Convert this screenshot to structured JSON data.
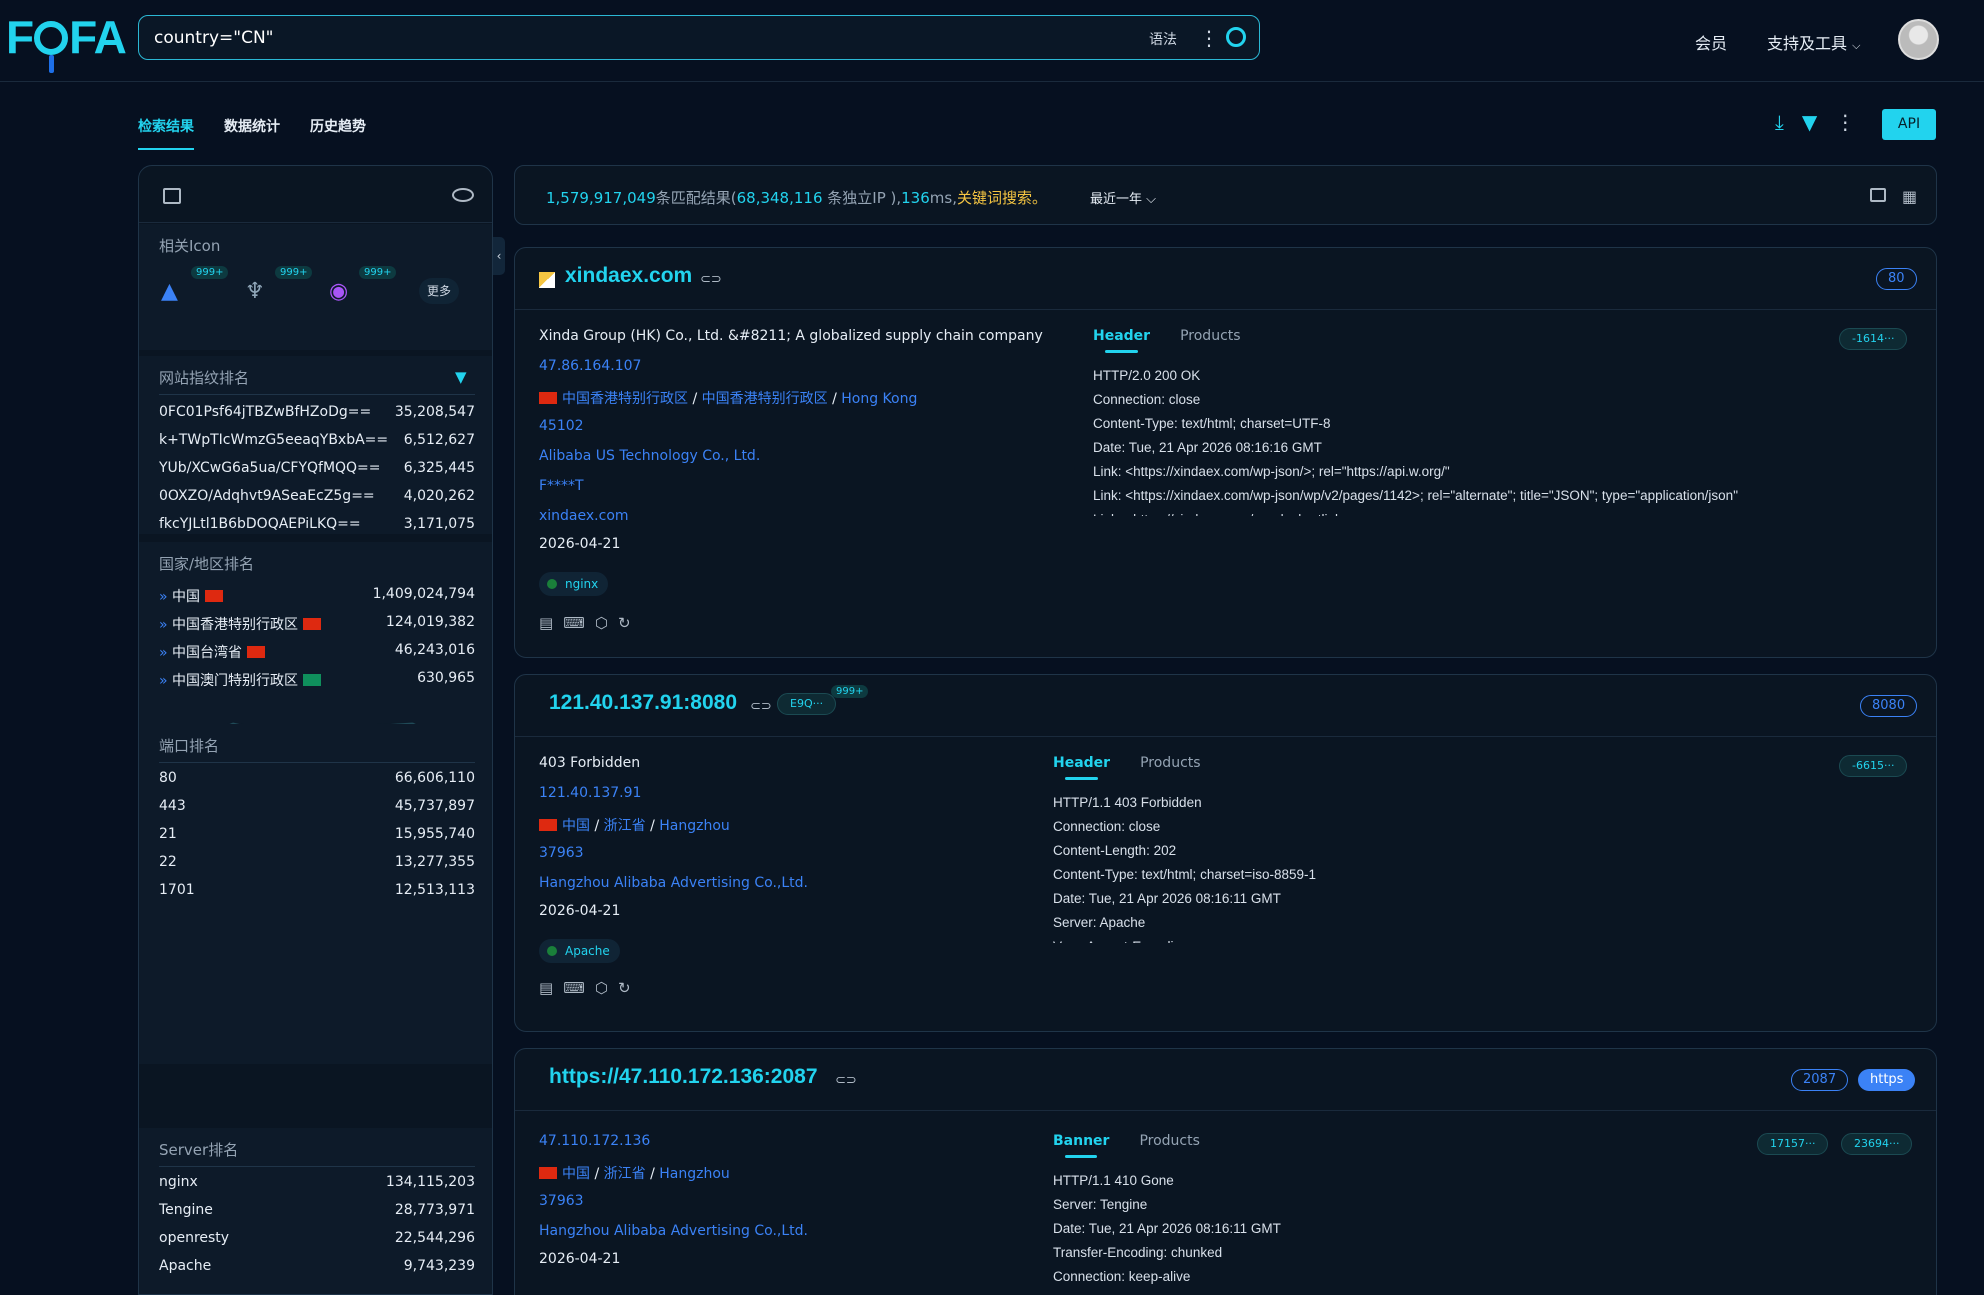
{
  "header": {
    "logo": "FOFA",
    "query": "country=\"CN\"",
    "syntax": "语法",
    "member": "会员",
    "tools": "支持及工具"
  },
  "tabs": [
    "检索结果",
    "数据统计",
    "历史趋势"
  ],
  "api": "API",
  "summary": {
    "total": "1,579,917,049",
    "t1": "条匹配结果(",
    "ips": "68,348,116",
    "t2": " 条独立IP ),",
    "ms": "136",
    "t3": "ms,",
    "kw": "关键词搜索。",
    "range": "最近一年"
  },
  "sidebar": {
    "icon_title": "相关Icon",
    "badge": "999+",
    "more": "更多",
    "fp_title": "网站指纹排名",
    "fp": [
      [
        "0FC01Psf64jTBZwBfHZoDg==",
        "35,208,547"
      ],
      [
        "k+TWpTIcWmzG5eeaqYBxbA==",
        "6,512,627"
      ],
      [
        "YUb/XCwG6a5ua/CFYQfMQQ==",
        "6,325,445"
      ],
      [
        "0OXZO/Adqhvt9ASeaEcZ5g==",
        "4,020,262"
      ],
      [
        "fkcYJLtl1B6bDOQAEPiLKQ==",
        "3,171,075"
      ]
    ],
    "country_title": "国家/地区排名",
    "countries": [
      [
        "中国",
        "1,409,024,794"
      ],
      [
        "中国香港特别行政区",
        "124,019,382"
      ],
      [
        "中国台湾省",
        "46,243,016"
      ],
      [
        "中国澳门特别行政区",
        "630,965"
      ]
    ],
    "port_title": "端口排名",
    "ports": [
      [
        "80",
        "66,606,110"
      ],
      [
        "443",
        "45,737,897"
      ],
      [
        "21",
        "15,955,740"
      ],
      [
        "22",
        "13,277,355"
      ],
      [
        "1701",
        "12,513,113"
      ]
    ],
    "server_title": "Server排名",
    "servers": [
      [
        "nginx",
        "134,115,203"
      ],
      [
        "Tengine",
        "28,773,971"
      ],
      [
        "openresty",
        "22,544,296"
      ],
      [
        "Apache",
        "9,743,239"
      ]
    ]
  },
  "cards": [
    {
      "host": "xindaex.com",
      "port": "80",
      "title": "Xinda Group (HK) Co., Ltd. &#8211; A globalized supply chain company",
      "ip": "47.86.164.107",
      "loc1": "中国香港特别行政区",
      "loc2": "中国香港特别行政区",
      "loc3": "Hong Kong",
      "asn": "45102",
      "org": "Alibaba US Technology Co., Ltd.",
      "cert": "F****T",
      "domain": "xindaex.com",
      "date": "2026-04-21",
      "tag": "nginx",
      "tab_a": "Header",
      "tab_b": "Products",
      "hash": "-1614···",
      "lines": [
        "HTTP/2.0 200 OK",
        "Connection: close",
        "Content-Type: text/html; charset=UTF-8",
        "Date: Tue, 21 Apr 2026 08:16:16 GMT",
        "Link: <https://xindaex.com/wp-json/>; rel=\"https://api.w.org/\"",
        "Link: <https://xindaex.com/wp-json/wp/v2/pages/1142>; rel=\"alternate\"; title=\"JSON\"; type=\"application/json\"",
        "Link: <https://xindaex.com/>; rel=shortlink"
      ]
    },
    {
      "host": "121.40.137.91:8080",
      "port": "8080",
      "chip": "E9Q···",
      "badge": "999+",
      "title": "403 Forbidden",
      "ip": "121.40.137.91",
      "loc1": "中国",
      "loc2": "浙江省",
      "loc3": "Hangzhou",
      "asn": "37963",
      "org": "Hangzhou Alibaba Advertising Co.,Ltd.",
      "date": "2026-04-21",
      "tag": "Apache",
      "tab_a": "Header",
      "tab_b": "Products",
      "hash": "-6615···",
      "lines": [
        "HTTP/1.1 403 Forbidden",
        "Connection: close",
        "Content-Length: 202",
        "Content-Type: text/html; charset=iso-8859-1",
        "Date: Tue, 21 Apr 2026 08:16:11 GMT",
        "Server: Apache",
        "Vary: Accept-Encoding"
      ]
    },
    {
      "host": "https://47.110.172.136:2087",
      "port": "2087",
      "proto": "https",
      "ip": "47.110.172.136",
      "loc1": "中国",
      "loc2": "浙江省",
      "loc3": "Hangzhou",
      "asn": "37963",
      "org": "Hangzhou Alibaba Advertising Co.,Ltd.",
      "date": "2026-04-21",
      "tab_a": "Banner",
      "tab_b": "Products",
      "hash": "17157···",
      "hash2": "23694···",
      "lines": [
        "HTTP/1.1 410 Gone",
        "Server: Tengine",
        "Date: Tue, 21 Apr 2026 08:16:11 GMT",
        "Transfer-Encoding: chunked",
        "Connection: keep-alive"
      ]
    }
  ]
}
